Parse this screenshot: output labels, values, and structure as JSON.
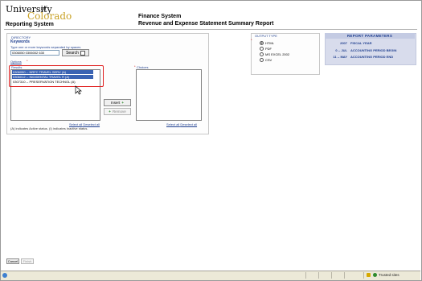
{
  "header": {
    "logo_main": "University",
    "logo_of": "of",
    "logo_sub": "Colorado",
    "system_name": "Reporting System",
    "app_title": "Finance System",
    "app_subtitle": "Revenue and Expense Statement Summary Report"
  },
  "directory": {
    "section_label": "DIRECTORY",
    "keywords_label": "Keywords",
    "keywords_help": "Type one or more keywords separated by spaces",
    "keywords_value": "0306050 0306002 630",
    "search_label": "Search",
    "options_link": "Options",
    "results_label": "Results",
    "results": [
      "0306050 -- NRFC TRAVEL SERV (A)",
      "0306012 -- INCIDENTAL TRAVEL R (A)",
      "0307310 -- PRESERVATION TECHNOL (A)"
    ],
    "insert_label": "Insert",
    "remove_label": "Remove",
    "choices_label": "Choices",
    "select_all_label": "Select all",
    "deselect_all_label": "Deselect all",
    "footnote": "(A) indicates Active status. (I) indicates Inactive status."
  },
  "output_type": {
    "label": "OUTPUT TYPE",
    "options": [
      "HTML",
      "PDF",
      "MS EXCEL 2002",
      "CSV"
    ],
    "selected": "HTML"
  },
  "report_parameters": {
    "title": "REPORT PARAMETERS",
    "rows": [
      {
        "value": "2007",
        "label": "FISCAL YEAR"
      },
      {
        "value": "0 -- JUL",
        "label": "ACCOUNTING PERIOD BEGIN"
      },
      {
        "value": "11 -- MAY",
        "label": "ACCOUNTING PERIOD END"
      }
    ]
  },
  "buttons": {
    "cancel": "Cancel",
    "finish": "Finish"
  },
  "statusbar": {
    "zone": "Trusted sites"
  }
}
